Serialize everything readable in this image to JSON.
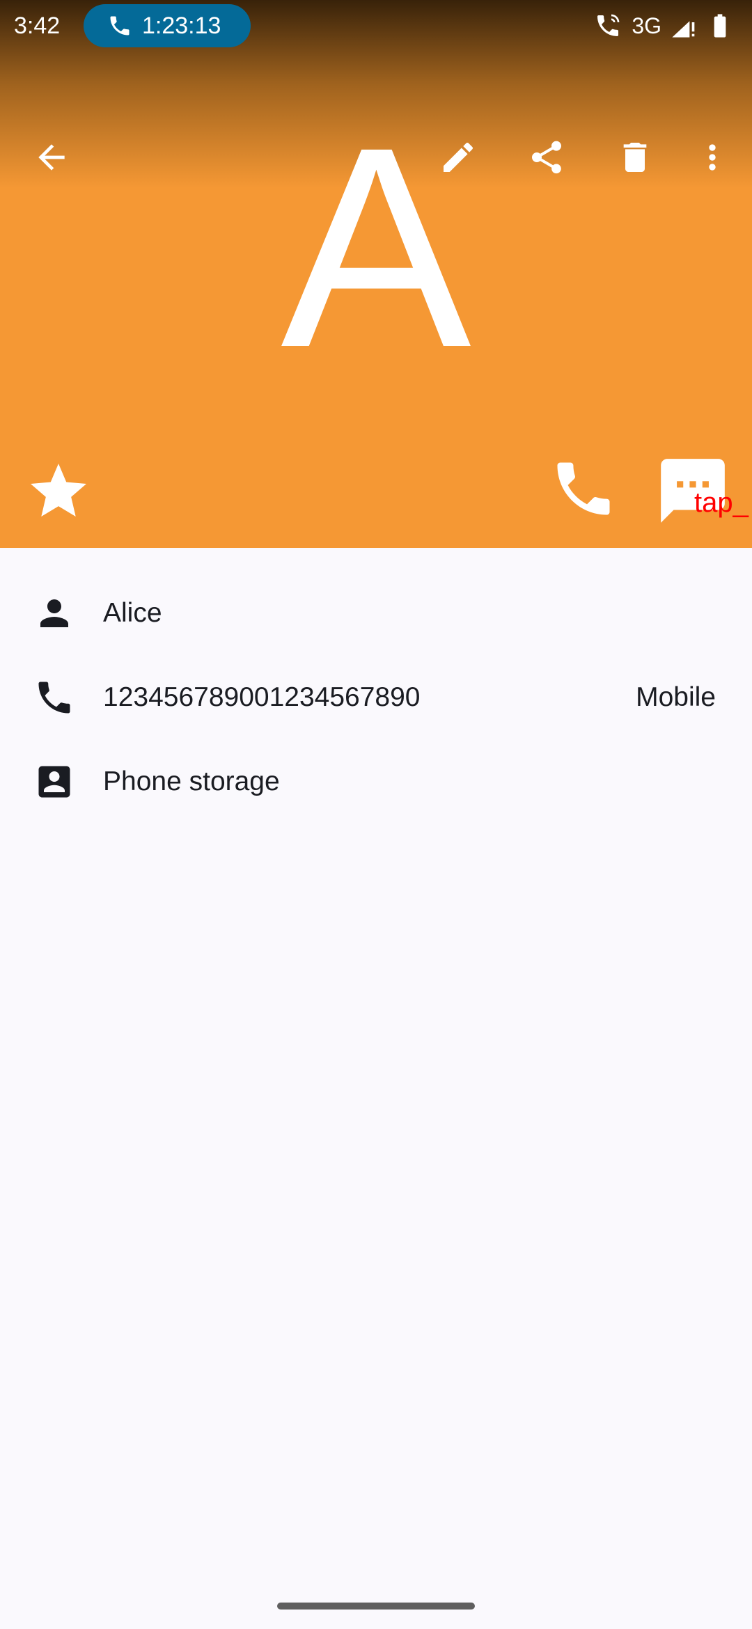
{
  "status_bar": {
    "time": "3:42",
    "call_duration": "1:23:13",
    "network": "3G"
  },
  "header": {
    "avatar_letter": "A",
    "background_color": "#F59834",
    "tap_label": "tap_"
  },
  "toolbar": {
    "icons": [
      "back-arrow-icon",
      "edit-icon",
      "share-icon",
      "delete-icon",
      "more-vert-icon"
    ]
  },
  "actions": {
    "icons": [
      "star-icon",
      "phone-icon",
      "message-icon"
    ]
  },
  "details": {
    "name": "Alice",
    "phone_number": "12345678900123456789​0",
    "phone_type": "Mobile",
    "storage": "Phone storage"
  }
}
